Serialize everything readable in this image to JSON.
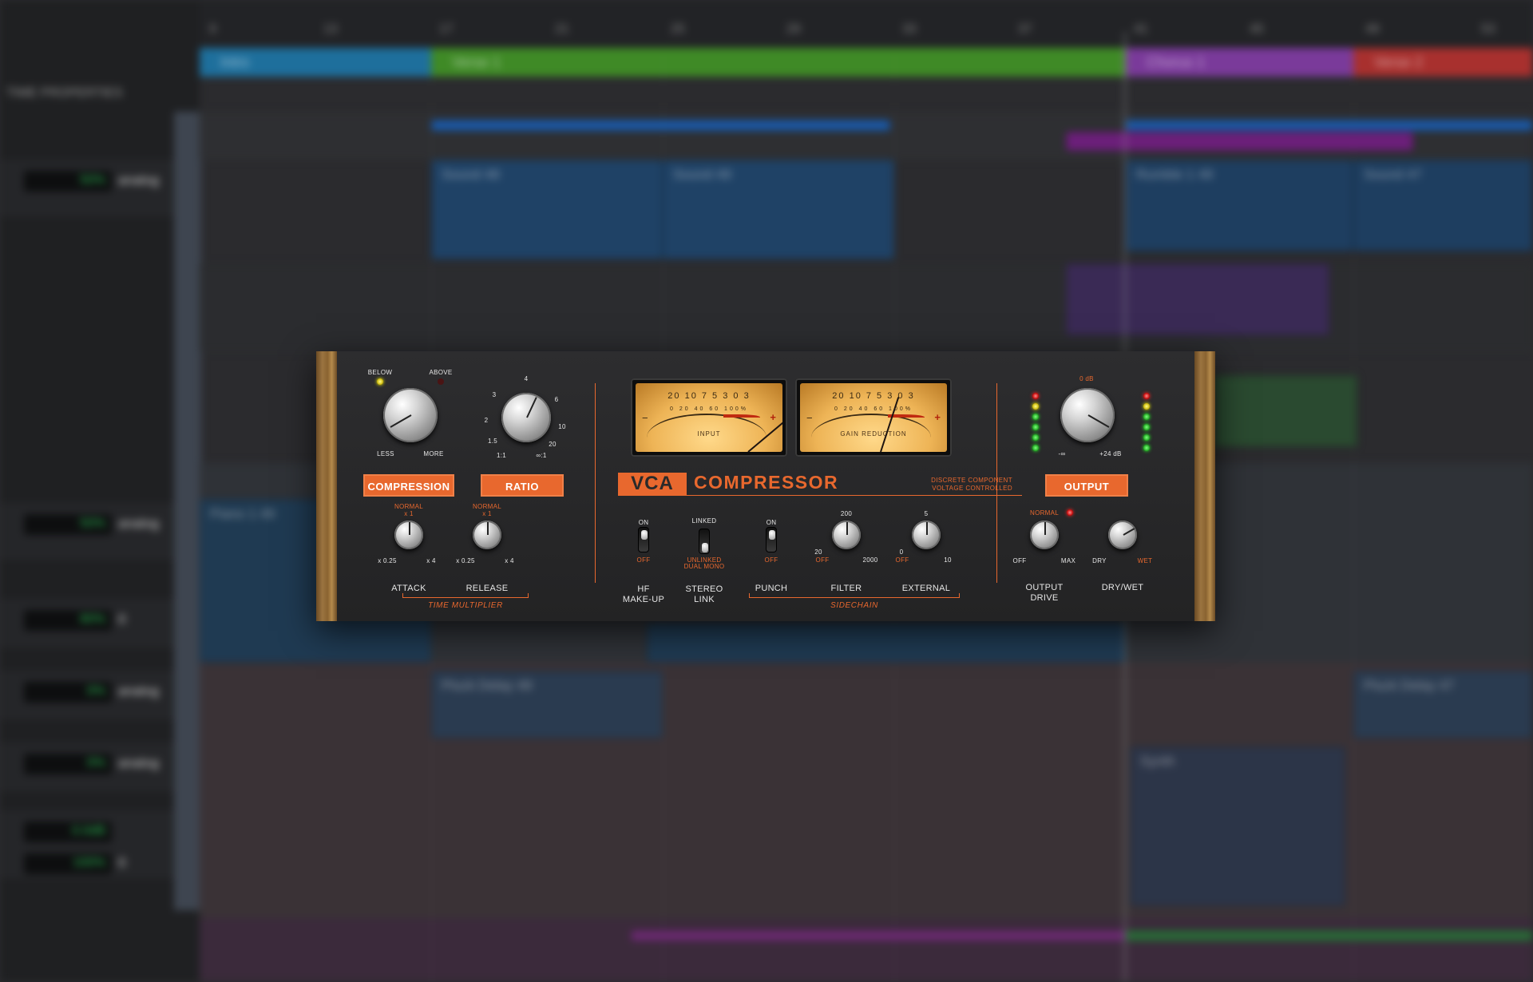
{
  "daw": {
    "left_panel_title": "TIME PROPERTIES",
    "ruler_ticks": [
      "9",
      "13",
      "17",
      "21",
      "25",
      "29",
      "33",
      "37",
      "41",
      "45",
      "49",
      "53"
    ],
    "markers": [
      {
        "name": "Intro",
        "color": "#1e6f9c"
      },
      {
        "name": "Verse 1",
        "color": "#3f8a26"
      },
      {
        "name": "Chorus 1",
        "color": "#7a3a9a"
      },
      {
        "name": "Verse 2",
        "color": "#a8302e"
      }
    ],
    "tracks": [
      {
        "meter": "50%",
        "name": "analog"
      },
      {
        "meter": "50%",
        "name": "analog"
      },
      {
        "meter": "80%",
        "name": "0"
      },
      {
        "meter": "0%",
        "name": "analog"
      },
      {
        "meter": "0%",
        "name": "analog"
      },
      {
        "meter": "0.0dB",
        "name": ""
      },
      {
        "meter": "100%",
        "name": "0"
      }
    ],
    "clips": [
      {
        "name": "Sound 48"
      },
      {
        "name": "Sound 49"
      },
      {
        "name": "Rumble 1 49"
      },
      {
        "name": "Sound 47"
      },
      {
        "name": "Piano 1 49"
      },
      {
        "name": "Pluck Delay 49"
      },
      {
        "name": "Pluck Delay 47"
      },
      {
        "name": "Synth"
      }
    ]
  },
  "plugin": {
    "title_prefix": "VCA",
    "title": "COMPRESSOR",
    "subtitle_1": "DISCRETE COMPONENT",
    "subtitle_2": "VOLTAGE CONTROLLED",
    "accent_color": "#e8682e",
    "compression": {
      "button": "COMPRESSION",
      "below": "BELOW",
      "above": "ABOVE",
      "less": "LESS",
      "more": "MORE"
    },
    "ratio": {
      "button": "RATIO",
      "ticks": [
        "1:1",
        "1.5",
        "2",
        "3",
        "4",
        "6",
        "10",
        "20",
        "∞:1"
      ]
    },
    "time_multiplier": {
      "label": "TIME MULTIPLIER",
      "attack": {
        "label": "ATTACK",
        "normal": "NORMAL",
        "x1": "x 1",
        "min": "x 0.25",
        "max": "x 4"
      },
      "release": {
        "label": "RELEASE",
        "normal": "NORMAL",
        "x1": "x 1",
        "min": "x 0.25",
        "max": "x 4"
      }
    },
    "meters": {
      "input": {
        "label": "INPUT",
        "scale": "20 10 7 5 3   0   3",
        "scale2": "0  20  40   60    100%"
      },
      "gain_reduction": {
        "label": "GAIN REDUCTION",
        "scale": "20 10 7 5 3   0   3",
        "scale2": "0  20  40   60    100%"
      }
    },
    "hf_makeup": {
      "label_1": "HF",
      "label_2": "MAKE-UP",
      "on": "ON",
      "off": "OFF"
    },
    "stereo_link": {
      "label_1": "STEREO",
      "label_2": "LINK",
      "linked": "LINKED",
      "unlinked_1": "UNLINKED",
      "unlinked_2": "DUAL MONO"
    },
    "sidechain": {
      "label": "SIDECHAIN",
      "punch": {
        "label": "PUNCH",
        "on": "ON",
        "off": "OFF"
      },
      "filter": {
        "label": "FILTER",
        "top": "200",
        "min": "20",
        "off": "OFF",
        "max": "2000"
      },
      "external": {
        "label": "EXTERNAL",
        "top": "5",
        "off": "OFF",
        "min": "0",
        "max": "10"
      }
    },
    "output": {
      "button": "OUTPUT",
      "zero_db": "0 dB",
      "min": "-∞",
      "max": "+24 dB",
      "drive": {
        "label_1": "OUTPUT",
        "label_2": "DRIVE",
        "normal": "NORMAL",
        "off": "OFF",
        "max": "MAX"
      },
      "drywet": {
        "label": "DRY/WET",
        "dry": "DRY",
        "wet": "WET"
      }
    }
  }
}
